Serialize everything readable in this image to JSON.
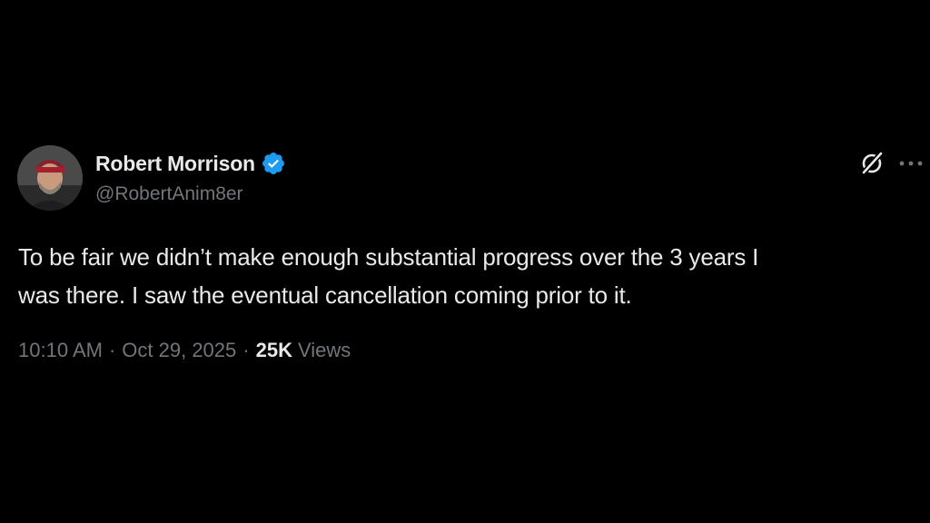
{
  "author": {
    "display_name": "Robert Morrison",
    "handle": "@RobertAnim8er",
    "verified": true,
    "verified_color": "#1d9bf0"
  },
  "icons": {
    "avatar": "profile-photo",
    "verified": "verified-badge-icon",
    "grok": "grok-icon",
    "more": "more-options-icon"
  },
  "tweet": {
    "text_line1": "To be fair we didn’t make enough substantial progress over the 3 years I",
    "text_line2": "was there. I saw the eventual cancellation coming prior to it."
  },
  "meta": {
    "time": "10:10 AM",
    "separator": "·",
    "date": "Oct 29, 2025",
    "views_count": "25K",
    "views_label": "Views"
  },
  "colors": {
    "background": "#000000",
    "primary_text": "#e7e9ea",
    "secondary_text": "#71767b",
    "accent": "#1d9bf0"
  }
}
